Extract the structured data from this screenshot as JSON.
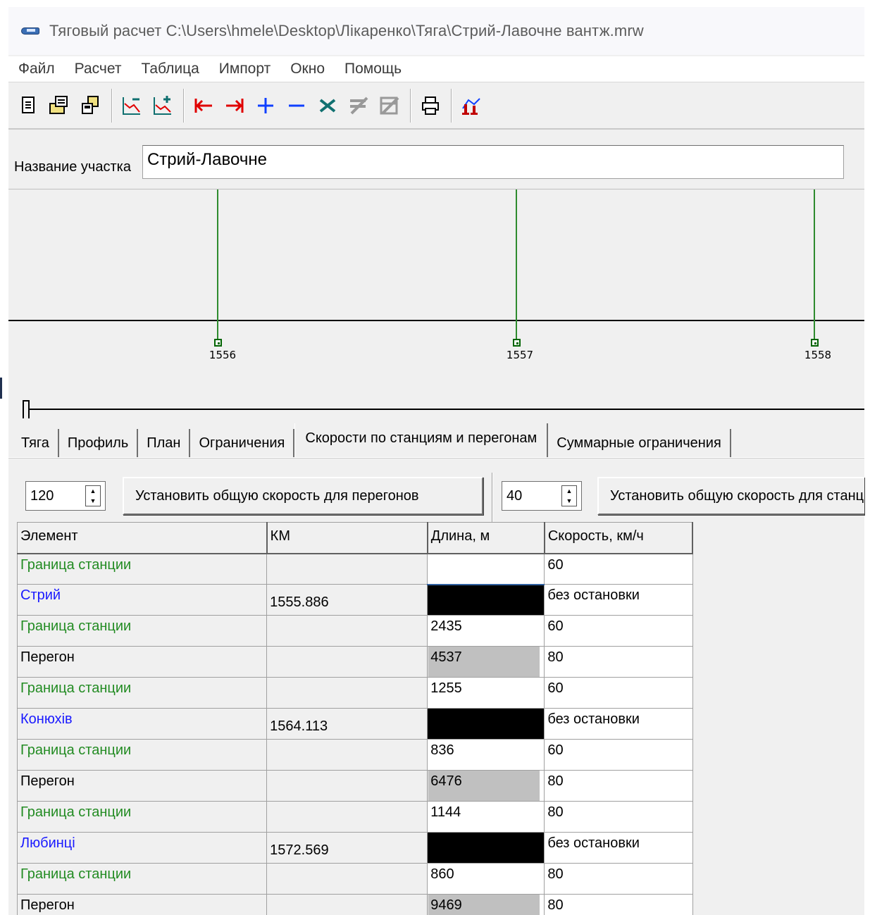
{
  "window": {
    "title": "Тяговый расчет   C:\\Users\\hmele\\Desktop\\Лікаренко\\Тяга\\Стрий-Лавочне вантж.mrw"
  },
  "menu": [
    "Файл",
    "Расчет",
    "Таблица",
    "Импорт",
    "Окно",
    "Помощь"
  ],
  "toolbar": {
    "buttons": [
      "new-icon",
      "open-icon",
      "save-icon",
      "chart-down-icon",
      "chart-add-icon",
      "go-start-icon",
      "go-end-icon",
      "add-icon",
      "remove-icon",
      "delete-icon",
      "delete-row-icon",
      "delete-all-icon",
      "print-icon",
      "train-icon"
    ],
    "colors": {
      "red": "#e00000",
      "blue": "#1040ff",
      "teal": "#107070"
    }
  },
  "section": {
    "label": "Название участка",
    "value": "Стрий-Лавочне"
  },
  "profile": {
    "km_labels": [
      "1556",
      "1557",
      "1558"
    ]
  },
  "tabs": [
    "Тяга",
    "Профиль",
    "План",
    "Ограничения",
    "Скорости по станциям и перегонам",
    "Суммарные ограничения"
  ],
  "active_tab": "Скорости по станциям и перегонам",
  "controls": {
    "haul_speed": "120",
    "haul_button": "Установить общую скорость для перегонов",
    "station_speed": "40",
    "station_button": "Установить общую скорость для станций"
  },
  "table": {
    "headers": [
      "Элемент",
      "КМ",
      "Длина, м",
      "Скорость, км/ч"
    ],
    "rows": [
      {
        "element": "Граница станции",
        "km": "",
        "length": "",
        "speed": "60",
        "kind": "border"
      },
      {
        "element": "Стрий",
        "km": "1555.886",
        "length": "",
        "speed": "без остановки",
        "kind": "station"
      },
      {
        "element": "Граница станции",
        "km": "",
        "length": "2435",
        "speed": "60",
        "kind": "border"
      },
      {
        "element": "Перегон",
        "km": "",
        "length": "4537",
        "speed": "80",
        "kind": "haul"
      },
      {
        "element": "Граница станции",
        "km": "",
        "length": "1255",
        "speed": "60",
        "kind": "border"
      },
      {
        "element": "Конюхів",
        "km": "1564.113",
        "length": "",
        "speed": "без остановки",
        "kind": "station"
      },
      {
        "element": "Граница станции",
        "km": "",
        "length": "836",
        "speed": "60",
        "kind": "border"
      },
      {
        "element": "Перегон",
        "km": "",
        "length": "6476",
        "speed": "80",
        "kind": "haul"
      },
      {
        "element": "Граница станции",
        "km": "",
        "length": "1144",
        "speed": "80",
        "kind": "border"
      },
      {
        "element": "Любинці",
        "km": "1572.569",
        "length": "",
        "speed": "без остановки",
        "kind": "station"
      },
      {
        "element": "Граница станции",
        "km": "",
        "length": "860",
        "speed": "80",
        "kind": "border"
      },
      {
        "element": "Перегон",
        "km": "",
        "length": "9469",
        "speed": "80",
        "kind": "haul"
      }
    ]
  }
}
